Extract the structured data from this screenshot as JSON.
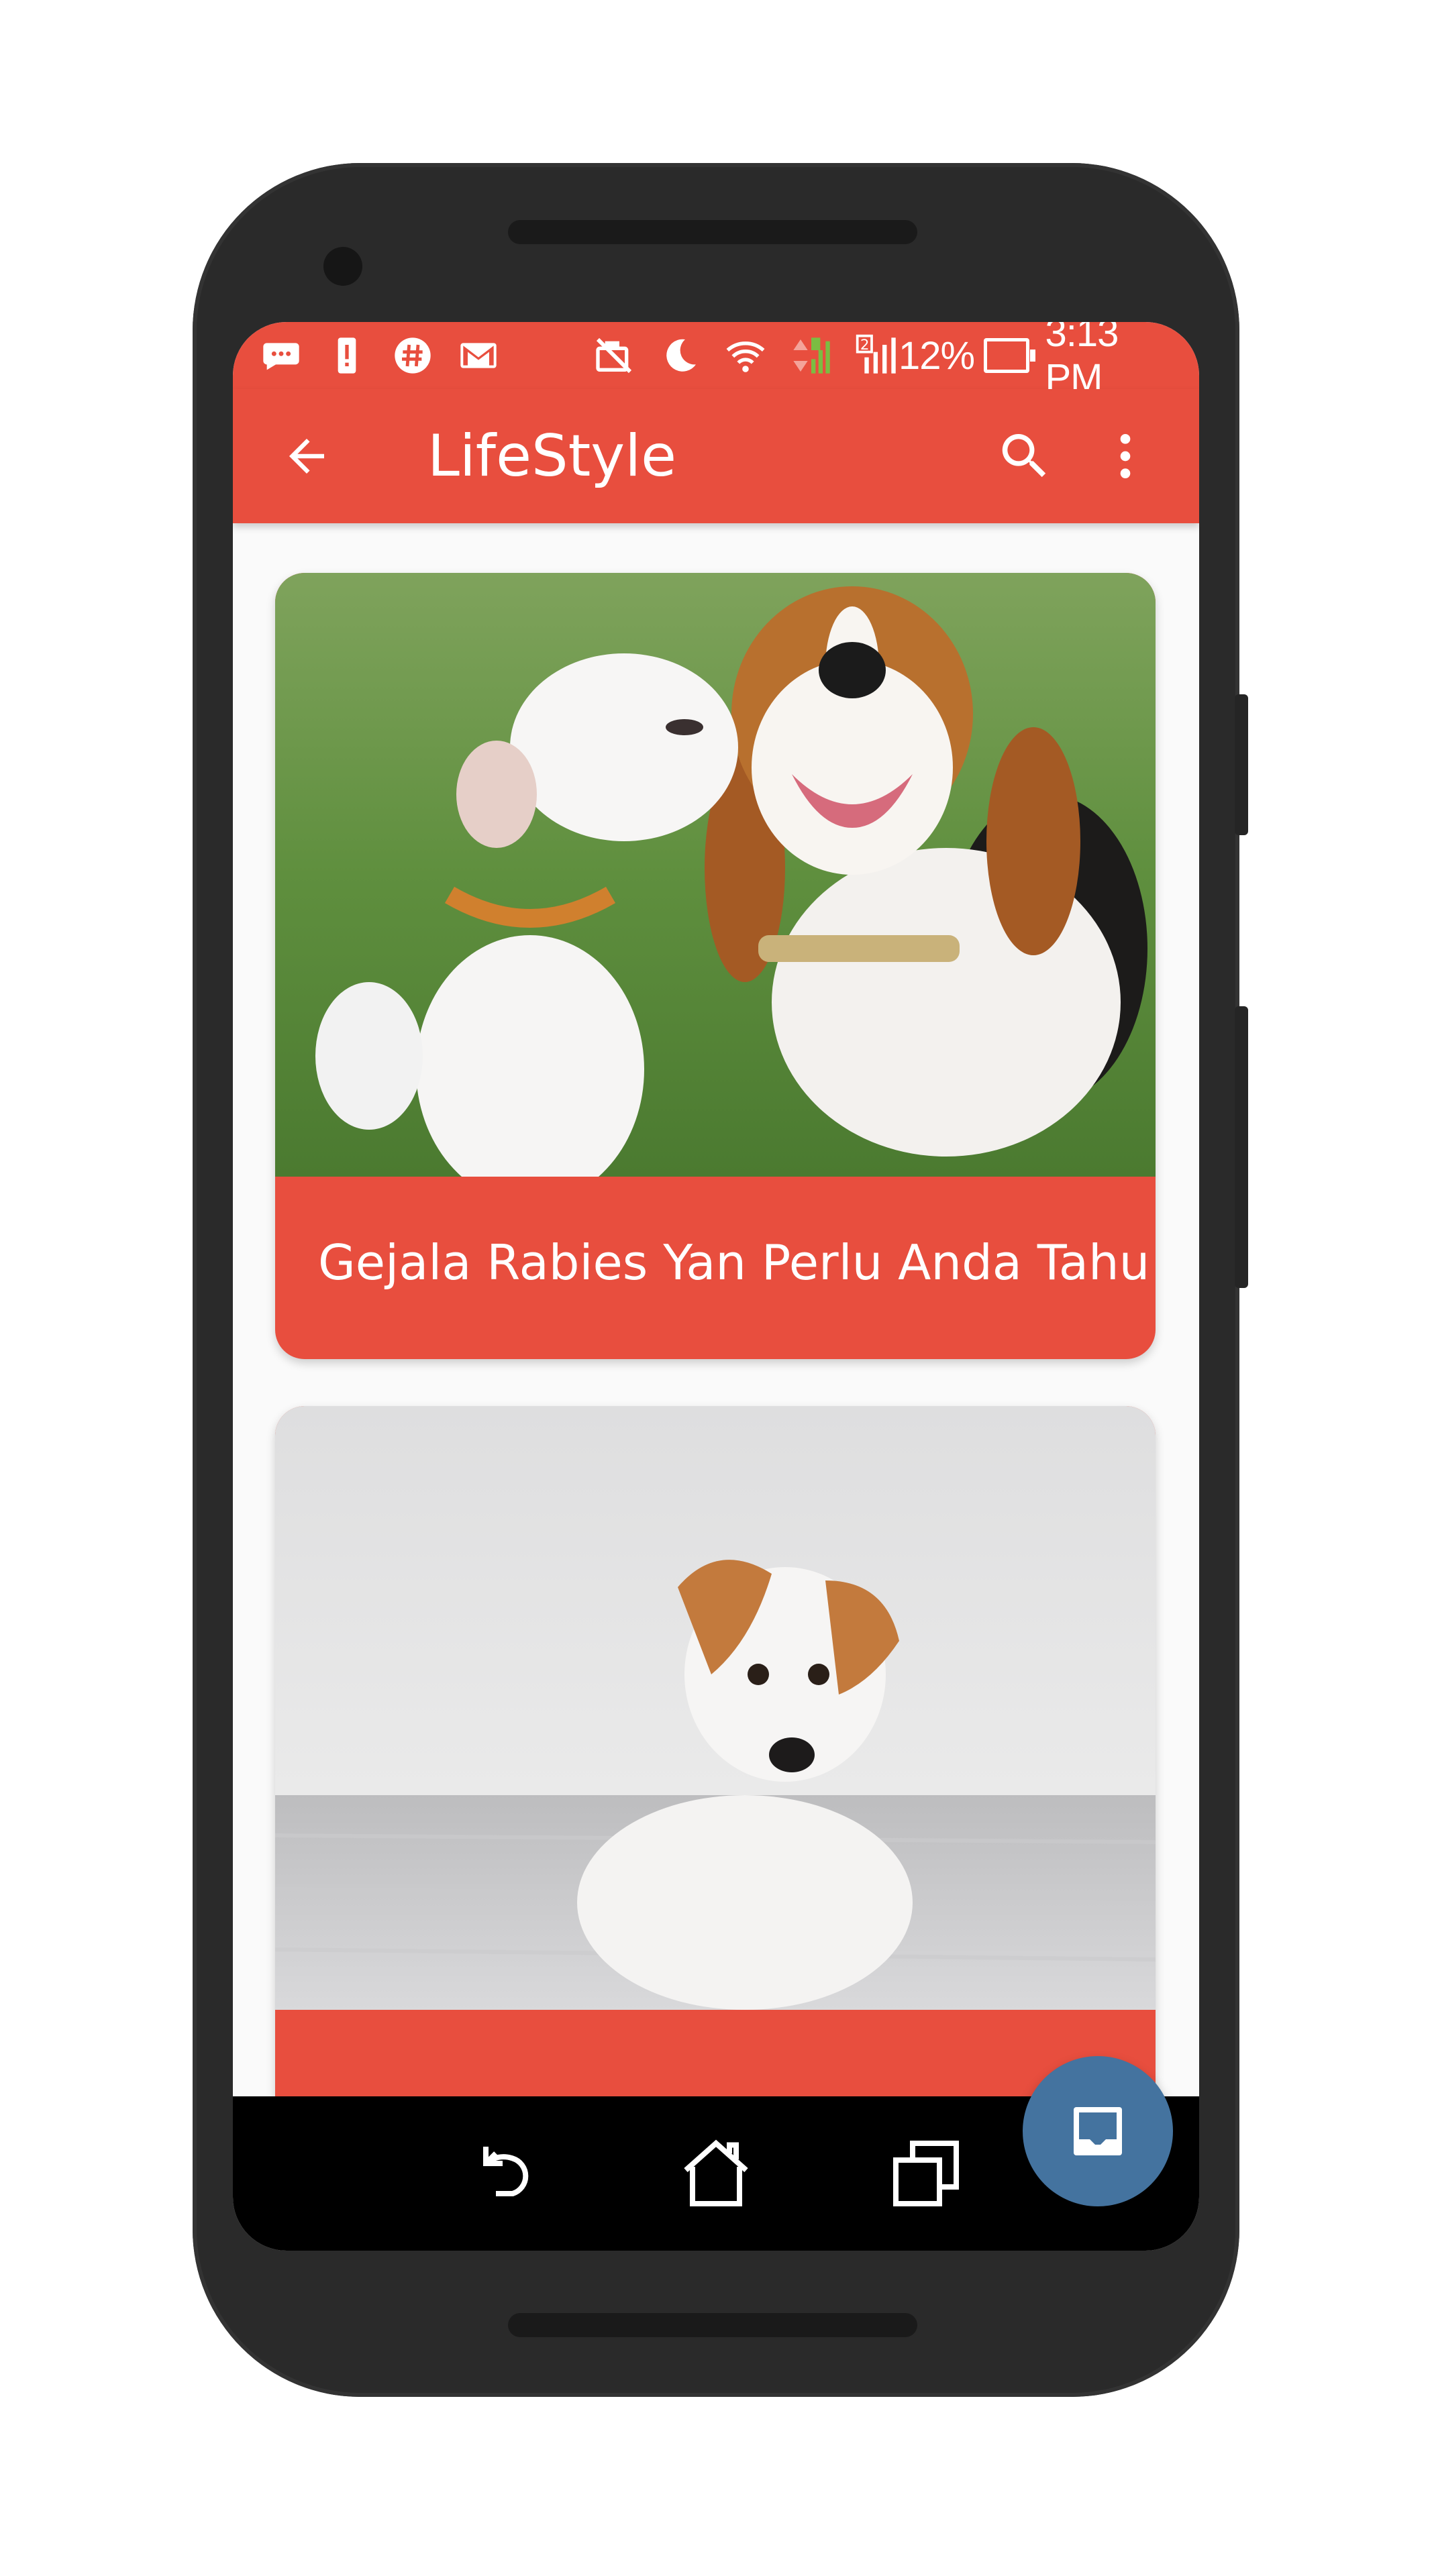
{
  "status_bar": {
    "battery_percent": "12%",
    "time": "3:13 PM",
    "signal_sim_number": "2",
    "icons": [
      "messenger-icon",
      "alert-icon",
      "hashtag-icon",
      "gmail-icon",
      "no-sync-icon",
      "moon-icon",
      "wifi-icon",
      "data-arrows-icon",
      "signal-icon",
      "battery-icon"
    ]
  },
  "app_bar": {
    "title": "LifeStyle",
    "back_icon": "arrow-back-icon",
    "search_icon": "search-icon",
    "more_icon": "more-vert-icon"
  },
  "cards": [
    {
      "title": "Gejala Rabies Yan Perlu Anda Tahu",
      "image_description_name": "dogs-photo"
    },
    {
      "title": "",
      "image_description_name": "dog-photo"
    }
  ],
  "fab": {
    "icon": "inbox-icon"
  },
  "nav_bar": {
    "icons": [
      "nav-back-icon",
      "nav-home-icon",
      "nav-recents-icon"
    ]
  },
  "colors": {
    "primary": "#e84e3e",
    "fab": "#44739f",
    "frame": "#2a2a2a",
    "nav": "#000000"
  }
}
